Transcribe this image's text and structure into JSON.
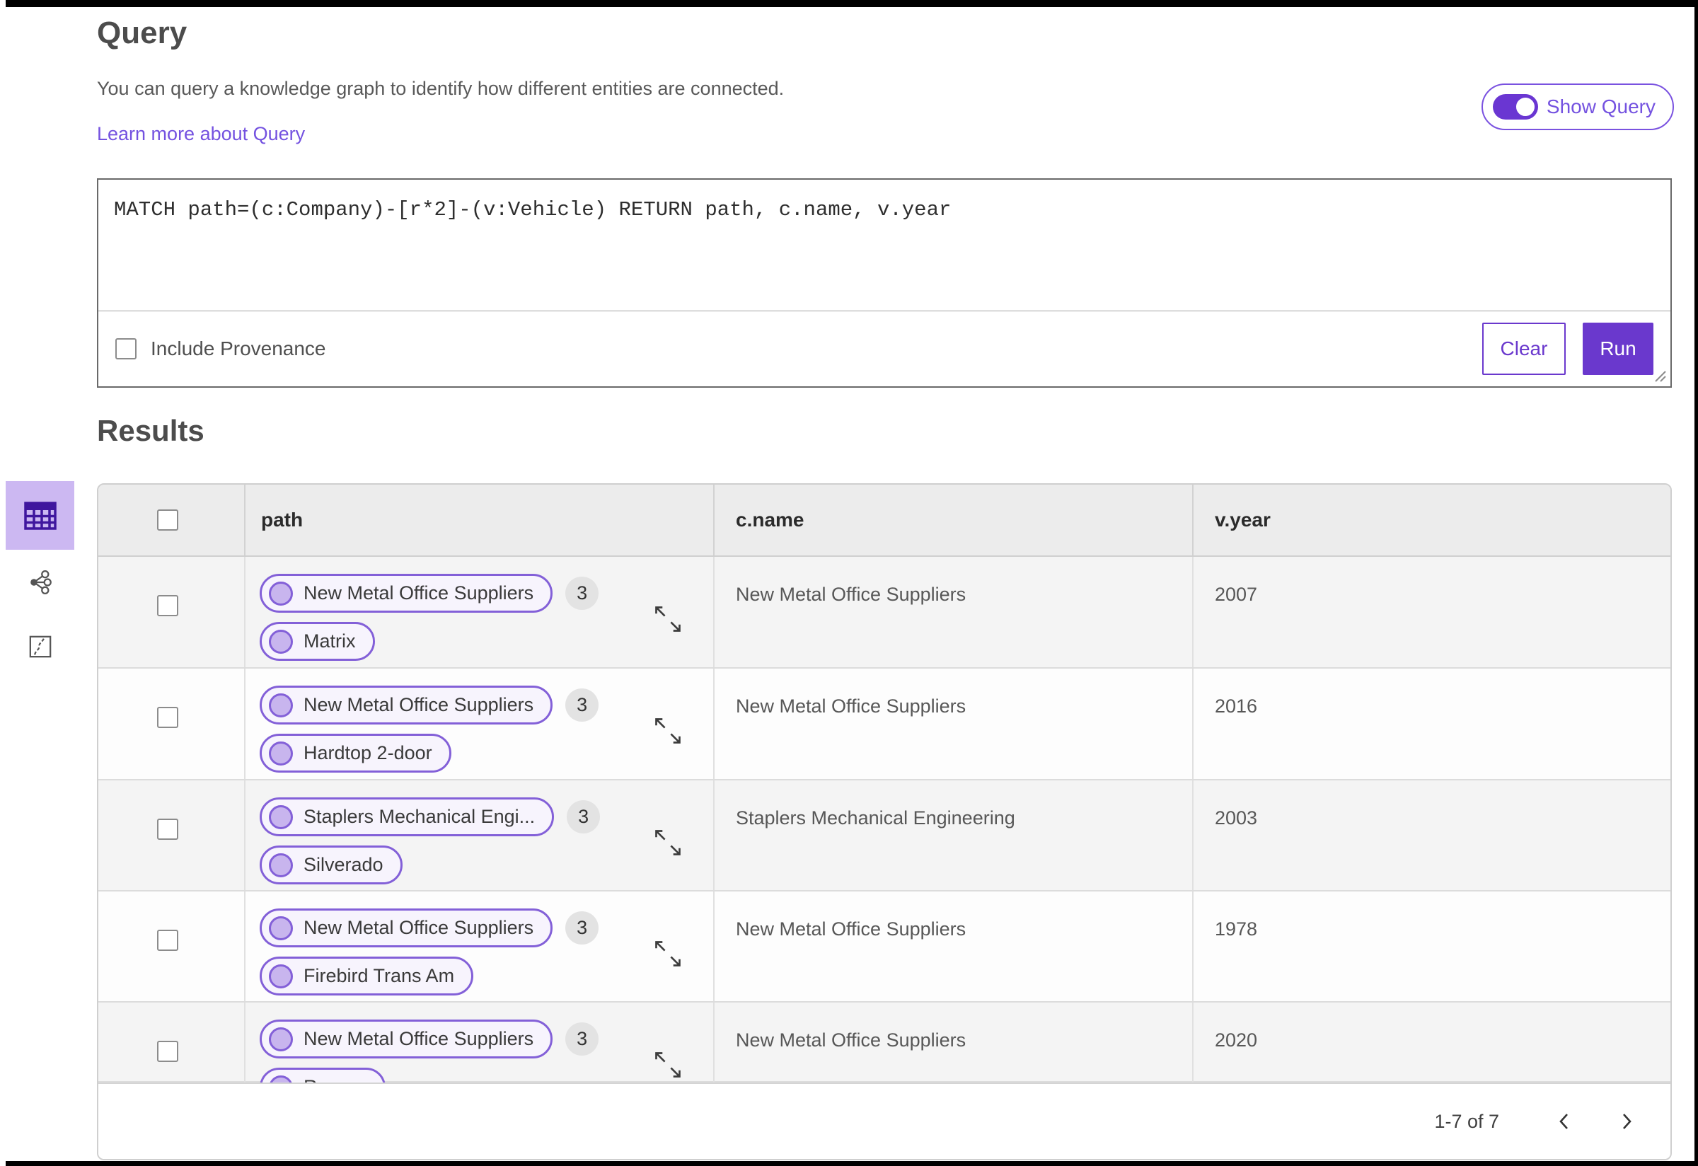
{
  "header": {
    "title": "Query",
    "description": "You can query a knowledge graph to identify how different entities are connected.",
    "learn_more": "Learn more about Query",
    "show_query": "Show Query"
  },
  "query": {
    "text": "MATCH path=(c:Company)-[r*2]-(v:Vehicle) RETURN path, c.name, v.year",
    "include_provenance": "Include Provenance",
    "clear": "Clear",
    "run": "Run"
  },
  "results": {
    "title": "Results",
    "columns": [
      "path",
      "c.name",
      "v.year"
    ],
    "rows": [
      {
        "pill1": "New Metal Office Suppliers",
        "pill2": "Matrix",
        "count": "3",
        "c_name": "New Metal Office Suppliers",
        "v_year": "2007"
      },
      {
        "pill1": "New Metal Office Suppliers",
        "pill2": "Hardtop 2-door",
        "count": "3",
        "c_name": "New Metal Office Suppliers",
        "v_year": "2016"
      },
      {
        "pill1": "Staplers Mechanical Engi...",
        "pill2": "Silverado",
        "count": "3",
        "c_name": "Staplers Mechanical Engineering",
        "v_year": "2003"
      },
      {
        "pill1": "New Metal Office Suppliers",
        "pill2": "Firebird Trans Am",
        "count": "3",
        "c_name": "New Metal Office Suppliers",
        "v_year": "1978"
      },
      {
        "pill1": "New Metal Office Suppliers",
        "pill2": "Ranger",
        "count": "3",
        "c_name": "New Metal Office Suppliers",
        "v_year": "2020"
      }
    ],
    "pagination": "1-7 of 7"
  },
  "colors": {
    "accent": "#6a38cd",
    "accent_light": "#ccb8f2",
    "link": "#7452e0",
    "pill_border": "#8360d8",
    "pill_bg": "#f7f4fd",
    "pill_dot": "#c8b5ee",
    "badge_bg": "#e3e3e3",
    "header_bg": "#ececec",
    "row_alt_bg": "#f4f4f4"
  }
}
